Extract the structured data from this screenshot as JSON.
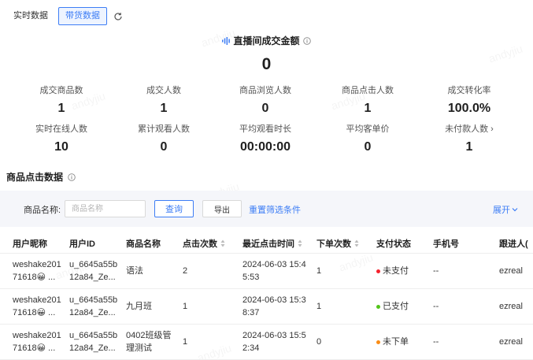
{
  "tabs": [
    {
      "label": "实时数据",
      "active": false
    },
    {
      "label": "带货数据",
      "active": true
    }
  ],
  "headline": {
    "title": "直播间成交金额",
    "value": "0"
  },
  "metrics_row1": [
    {
      "label": "成交商品数",
      "value": "1"
    },
    {
      "label": "成交人数",
      "value": "1"
    },
    {
      "label": "商品浏览人数",
      "value": "0"
    },
    {
      "label": "商品点击人数",
      "value": "1"
    },
    {
      "label": "成交转化率",
      "value": "100.0%"
    }
  ],
  "metrics_row2": [
    {
      "label": "实时在线人数",
      "value": "10"
    },
    {
      "label": "累计观看人数",
      "value": "0"
    },
    {
      "label": "平均观看时长",
      "value": "00:00:00"
    },
    {
      "label": "平均客单价",
      "value": "0"
    },
    {
      "label": "未付款人数 ›",
      "value": "1"
    }
  ],
  "section": {
    "title": "商品点击数据"
  },
  "filter": {
    "label": "商品名称:",
    "placeholder": "商品名称",
    "query_label": "查询",
    "export_label": "导出",
    "reset_label": "重置筛选条件",
    "expand_label": "展开"
  },
  "table": {
    "headers": [
      "用户昵称",
      "用户ID",
      "商品名称",
      "点击次数",
      "最近点击时间",
      "下单次数",
      "支付状态",
      "手机号",
      "跟进人("
    ],
    "rows": [
      {
        "nickname": [
          "weshake201",
          "71618😀 ..."
        ],
        "user_id": [
          "u_6645a55b",
          "12a84_Ze..."
        ],
        "product": [
          "语法"
        ],
        "clicks": "2",
        "last_click": [
          "2024-06-03 15:4",
          "5:53"
        ],
        "orders": "1",
        "status": "未支付",
        "status_color": "#f5222d",
        "phone": "--",
        "follower": "ezreal"
      },
      {
        "nickname": [
          "weshake201",
          "71618😀 ..."
        ],
        "user_id": [
          "u_6645a55b",
          "12a84_Ze..."
        ],
        "product": [
          "九月班"
        ],
        "clicks": "1",
        "last_click": [
          "2024-06-03 15:3",
          "8:37"
        ],
        "orders": "1",
        "status": "已支付",
        "status_color": "#52c41a",
        "phone": "--",
        "follower": "ezreal"
      },
      {
        "nickname": [
          "weshake201",
          "71618😀 ..."
        ],
        "user_id": [
          "u_6645a55b",
          "12a84_Ze..."
        ],
        "product": [
          "0402班级管",
          "理测试"
        ],
        "clicks": "1",
        "last_click": [
          "2024-06-03 15:5",
          "2:34"
        ],
        "orders": "0",
        "status": "未下单",
        "status_color": "#fa8c16",
        "phone": "--",
        "follower": "ezreal"
      }
    ]
  },
  "colors": {
    "accent": "#3d7df5"
  }
}
